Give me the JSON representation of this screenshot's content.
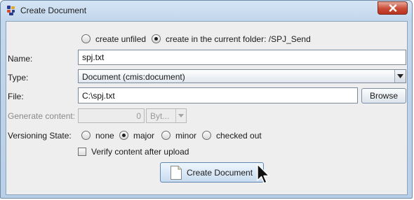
{
  "window": {
    "title": "Create Document"
  },
  "location": {
    "options": [
      {
        "label": "create unfiled",
        "selected": false
      },
      {
        "label": "create in the current folder: /SPJ_Send",
        "selected": true
      }
    ]
  },
  "form": {
    "name_label": "Name:",
    "name_value": "spj.txt",
    "type_label": "Type:",
    "type_value": "Document (cmis:document)",
    "file_label": "File:",
    "file_value": "C:\\spj.txt",
    "browse_label": "Browse",
    "generate_label": "Generate content:",
    "generate_value": "0",
    "generate_unit": "Byt...",
    "versioning_label": "Versioning State:",
    "versioning_options": [
      {
        "label": "none",
        "selected": false
      },
      {
        "label": "major",
        "selected": true
      },
      {
        "label": "minor",
        "selected": false
      },
      {
        "label": "checked out",
        "selected": false
      }
    ],
    "verify_label": "Verify content after upload",
    "verify_checked": false
  },
  "actions": {
    "create_label": "Create Document"
  },
  "icons": {
    "app": "app-icon",
    "close": "close-icon",
    "document": "document-icon",
    "cursor": "mouse-cursor-icon",
    "dropdown": "chevron-down-icon"
  }
}
